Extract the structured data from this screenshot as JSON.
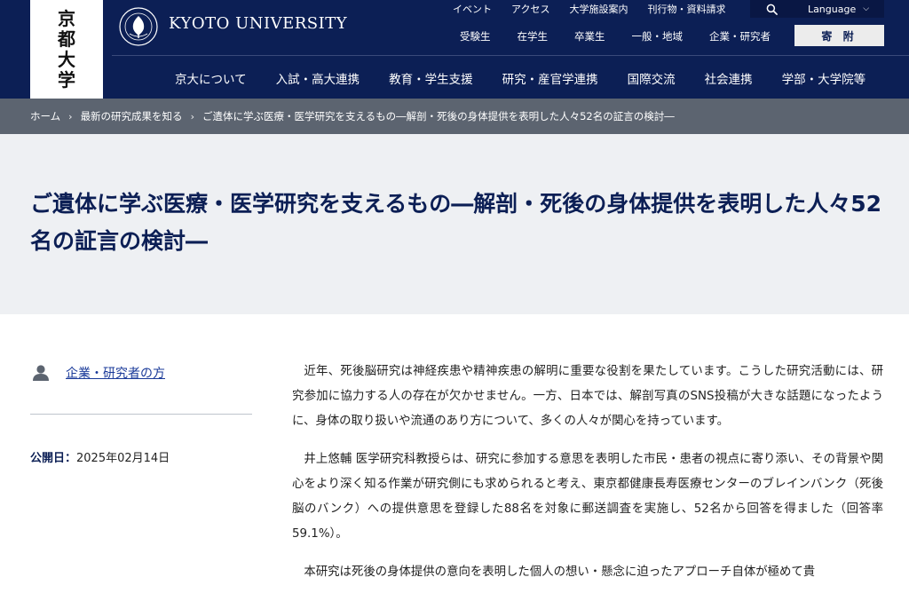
{
  "header": {
    "logo_chars": [
      "京",
      "都",
      "大",
      "学"
    ],
    "university_name": "KYOTO UNIVERSITY",
    "utility_links": [
      "イベント",
      "アクセス",
      "大学施設案内",
      "刊行物・資料請求"
    ],
    "language_label": "Language",
    "audience_links": [
      "受験生",
      "在学生",
      "卒業生",
      "一般・地域",
      "企業・研究者"
    ],
    "donate_label": "寄 附",
    "main_nav": [
      "京大について",
      "入試・高大連携",
      "教育・学生支援",
      "研究・産官学連携",
      "国際交流",
      "社会連携",
      "学部・大学院等"
    ]
  },
  "breadcrumb": [
    "ホーム",
    "最新の研究成果を知る",
    "ご遺体に学ぶ医療・医学研究を支えるもの―解剖・死後の身体提供を表明した人々52名の証言の検討―"
  ],
  "title": "ご遺体に学ぶ医療・医学研究を支えるもの―解剖・死後の身体提供を表明した人々52名の証言の検討―",
  "sidebar": {
    "audience_link": "企業・研究者の方",
    "published_label": "公開日：",
    "published_date": "2025年02月14日"
  },
  "article": {
    "paragraphs": [
      "近年、死後脳研究は神経疾患や精神疾患の解明に重要な役割を果たしています。こうした研究活動には、研究参加に協力する人の存在が欠かせません。一方、日本では、解剖写真のSNS投稿が大きな話題になったように、身体の取り扱いや流通のあり方について、多くの人々が関心を持っています。",
      "井上悠輔 医学研究科教授らは、研究に参加する意思を表明した市民・患者の視点に寄り添い、その背景や関心をより深く知る作業が研究側にも求められると考え、東京都健康長寿医療センターのブレインバンク（死後脳のバンク）への提供意思を登録した88名を対象に郵送調査を実施し、52名から回答を得ました（回答率59.1%）。",
      "本研究は死後の身体提供の意向を表明した個人の想い・懸念に迫ったアプローチ自体が極めて貴"
    ]
  },
  "colors": {
    "header_bg": "#0c1f55",
    "breadcrumb_bg": "#5c6470",
    "title_band_bg": "#eef0f3",
    "link": "#1a3a99"
  }
}
